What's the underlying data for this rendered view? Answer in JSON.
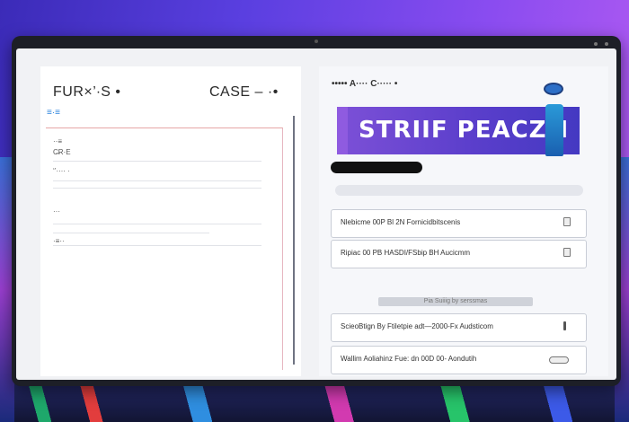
{
  "app": {
    "brand": "FUR×’·S •",
    "brand_sub": "≡·≡",
    "case_title": "CASE – ·•"
  },
  "form": {
    "field1": "··≡",
    "field2": "C̶̶R·E",
    "field3": "‘’···· ·",
    "field4": "···",
    "field5": "·≡··"
  },
  "right": {
    "title": "••••• A···· C····· •",
    "banner_text": "STRIIF PEACZ´I",
    "rows": [
      {
        "text": "Nlebicme 00P Bl 2N Fornicidbitscenis"
      },
      {
        "text": "Ripiac 00 PB HASDI/FSbip BH Aucicmm"
      },
      {
        "text": "ScieoBtign By Ftiletpie adt—2000-Fx Audsticom"
      },
      {
        "text": "Wallim Aoliahinz Fue: dn 00D 00- Aondutih"
      }
    ],
    "section_label": "Pia Suiiig by serssmas"
  },
  "colors": {
    "banner": "#5a3ecb",
    "accent": "#2e86de",
    "wallpaper": "#5a3fe0"
  }
}
